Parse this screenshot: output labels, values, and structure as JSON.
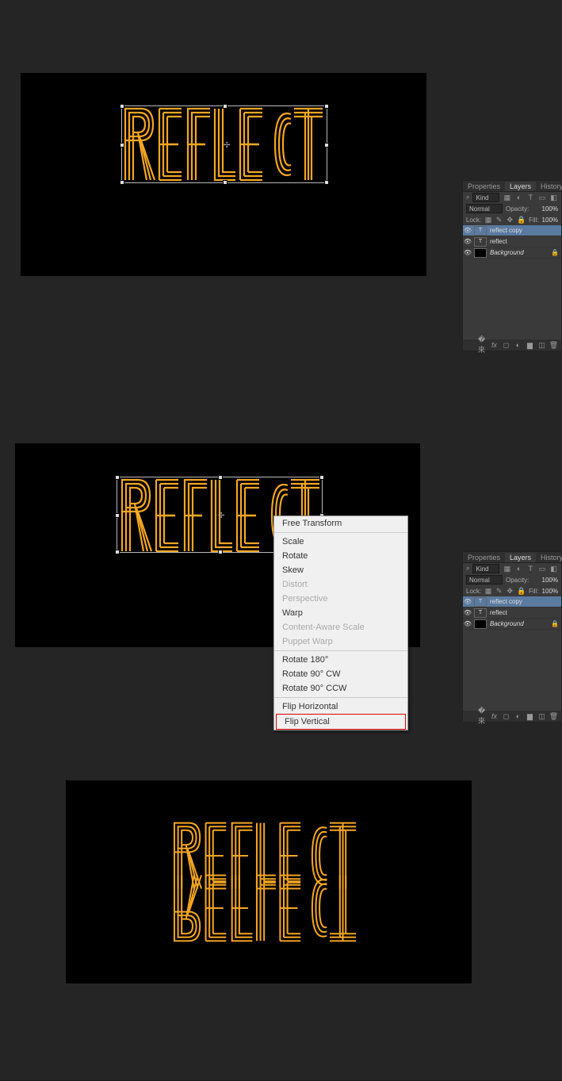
{
  "canvas_text": "REFLECT",
  "panel": {
    "tabs": [
      "Properties",
      "Layers",
      "History"
    ],
    "active_tab": "Layers",
    "kind_label": "Kind",
    "blend_mode": "Normal",
    "opacity_label": "Opacity:",
    "opacity_value": "100%",
    "lock_label": "Lock:",
    "fill_label": "Fill:",
    "fill_value": "100%",
    "layers": [
      {
        "name": "reflect copy",
        "type": "T",
        "selected": true,
        "visible": true
      },
      {
        "name": "reflect",
        "type": "T",
        "selected": false,
        "visible": true
      },
      {
        "name": "Background",
        "type": "bg",
        "selected": false,
        "visible": true,
        "locked": true
      }
    ],
    "bottom_icons": [
      "link-icon",
      "fx-icon",
      "mask-icon",
      "adjust-icon",
      "group-icon",
      "new-icon",
      "trash-icon"
    ]
  },
  "context_menu": {
    "items": [
      {
        "label": "Free Transform",
        "enabled": true
      },
      {
        "sep": true
      },
      {
        "label": "Scale",
        "enabled": true
      },
      {
        "label": "Rotate",
        "enabled": true
      },
      {
        "label": "Skew",
        "enabled": true
      },
      {
        "label": "Distort",
        "enabled": false
      },
      {
        "label": "Perspective",
        "enabled": false
      },
      {
        "label": "Warp",
        "enabled": true
      },
      {
        "label": "Content-Aware Scale",
        "enabled": false
      },
      {
        "label": "Puppet Warp",
        "enabled": false
      },
      {
        "sep": true
      },
      {
        "label": "Rotate 180°",
        "enabled": true
      },
      {
        "label": "Rotate 90° CW",
        "enabled": true
      },
      {
        "label": "Rotate 90° CCW",
        "enabled": true
      },
      {
        "sep": true
      },
      {
        "label": "Flip Horizontal",
        "enabled": true
      },
      {
        "label": "Flip Vertical",
        "enabled": true,
        "highlighted": true
      }
    ]
  }
}
